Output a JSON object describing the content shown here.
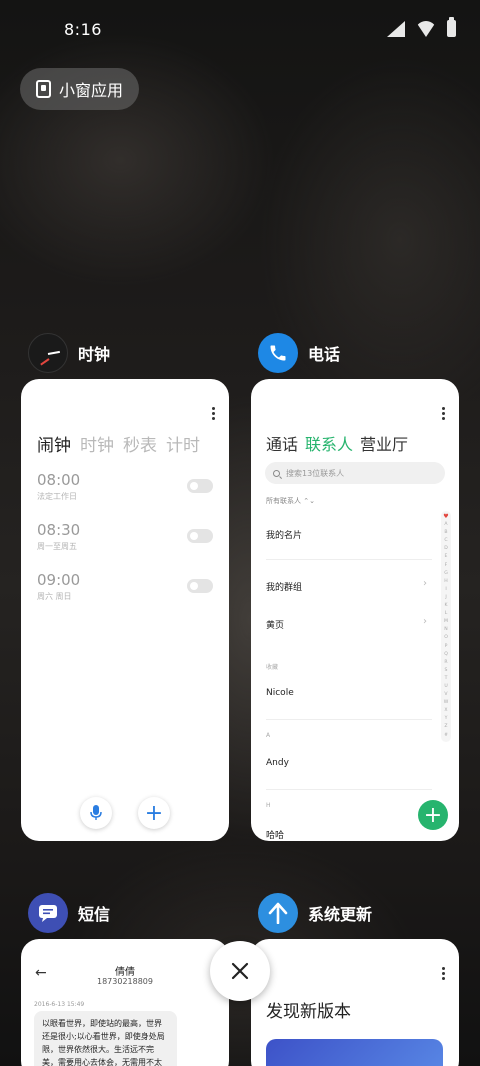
{
  "status_bar": {
    "time": "8:16"
  },
  "small_window": {
    "label": "小窗应用"
  },
  "apps": {
    "clock": {
      "name": "时钟",
      "tabs": [
        "闹钟",
        "时钟",
        "秒表",
        "计时"
      ],
      "alarms": [
        {
          "time": "08:00",
          "repeat": "法定工作日",
          "enabled": false
        },
        {
          "time": "08:30",
          "repeat": "周一至周五",
          "enabled": false
        },
        {
          "time": "09:00",
          "repeat": "周六 周日",
          "enabled": false
        }
      ],
      "add_symbol": "+"
    },
    "phone": {
      "name": "电话",
      "tabs": [
        "通话",
        "联系人",
        "营业厅"
      ],
      "search_placeholder": "搜索13位联系人",
      "filter": "所有联系人",
      "rows": {
        "my_card": "我的名片",
        "my_groups": "我的群组",
        "yellow_pages": "黄页",
        "section_fav": "收藏",
        "nicole": "Nicole",
        "section_a": "A",
        "andy": "Andy",
        "section_h": "H",
        "haha": "哈哈"
      },
      "index": [
        "♥",
        "A",
        "B",
        "C",
        "D",
        "E",
        "F",
        "G",
        "H",
        "I",
        "J",
        "K",
        "L",
        "M",
        "N",
        "O",
        "P",
        "Q",
        "R",
        "S",
        "T",
        "U",
        "V",
        "W",
        "X",
        "Y",
        "Z",
        "#"
      ],
      "add_symbol": "+"
    },
    "sms": {
      "name": "短信",
      "contact_name": "倩倩",
      "contact_number": "18730218809",
      "timestamp": "2016-6-13 15:49",
      "message": "以眼看世界，即使站的最高，世界还是很小;以心看世界，即使身处局限，世界依然很大。生活远不完美，需要用心去体会，无需用不太"
    },
    "update": {
      "name": "系统更新",
      "title": "发现新版本"
    }
  },
  "close": {
    "symbol": "✕"
  }
}
